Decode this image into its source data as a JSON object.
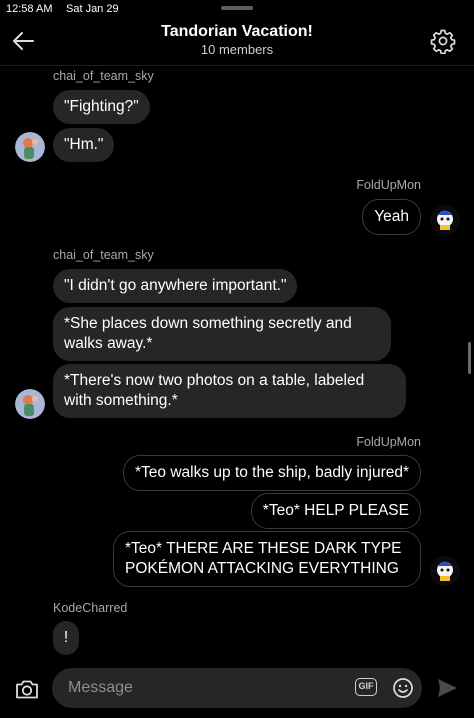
{
  "status_bar": {
    "time": "12:58 AM",
    "date": "Sat Jan 29"
  },
  "header": {
    "title": "Tandorian Vacation!",
    "subtitle": "10 members",
    "back_icon": "arrow-left-icon",
    "settings_icon": "gear-icon"
  },
  "messages": [
    {
      "sender": "chai_of_team_sky"
    },
    {
      "text": "\"Fighting?\""
    },
    {
      "text": "\"Hm.\""
    },
    {
      "sender": "FoldUpMon"
    },
    {
      "text": "Yeah"
    },
    {
      "sender": "chai_of_team_sky"
    },
    {
      "text": "\"I didn't go anywhere important.\""
    },
    {
      "text": "*She places down something secretly and walks away.*"
    },
    {
      "text": "*There's now two photos on a table, labeled with something.*"
    },
    {
      "sender": "FoldUpMon"
    },
    {
      "text": "*Teo walks up to the ship, badly injured*"
    },
    {
      "text": "*Teo* HELP PLEASE"
    },
    {
      "text": "*Teo* THERE ARE THESE DARK TYPE POKÉMON ATTACKING EVERYTHING"
    },
    {
      "sender": "KodeCharred"
    },
    {
      "text": "!"
    }
  ],
  "composer": {
    "placeholder": "Message",
    "gif_label": "GIF",
    "camera_icon": "camera-icon",
    "emoji_icon": "emoji-icon",
    "send_icon": "send-icon"
  },
  "colors": {
    "background": "#000000",
    "incoming_bubble": "#262626",
    "outgoing_border": "#3a3a3a",
    "sender_name": "#a8a8a8"
  }
}
